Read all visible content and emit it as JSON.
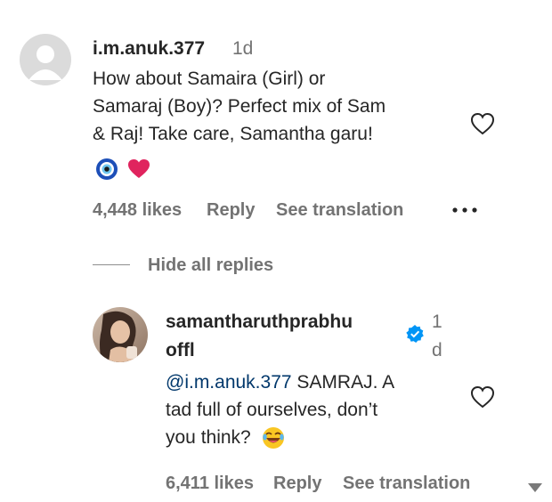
{
  "comment": {
    "username": "i.m.anuk.377",
    "time": "1d",
    "text_lines": [
      "How about Samaira (Girl) or",
      "Samaraj (Boy)? Perfect mix of Sam",
      "& Raj! Take care, Samantha garu!"
    ],
    "emojis": [
      "nazar-amulet-icon",
      "red-heart-icon"
    ],
    "likes": "4,448 likes",
    "reply_label": "Reply",
    "translate_label": "See translation",
    "more_icon": "more-options-icon"
  },
  "replies_toggle": "Hide all replies",
  "reply": {
    "username_line1": "samantharuthprabhu",
    "username_line2": "offl",
    "verified": true,
    "time_line1": "1",
    "time_line2": "d",
    "mention": "@i.m.anuk.377",
    "text_line1_rest": " SAMRAJ. A",
    "text_line2": "tad full of ourselves, don’t",
    "text_line3": "you think?",
    "emoji": "rolling-on-floor-laughing-icon",
    "likes": "6,411 likes",
    "reply_label": "Reply",
    "translate_label": "See translation"
  },
  "colors": {
    "text": "#262626",
    "secondary": "#737373",
    "mention": "#00376b",
    "verified": "#0095f6"
  }
}
